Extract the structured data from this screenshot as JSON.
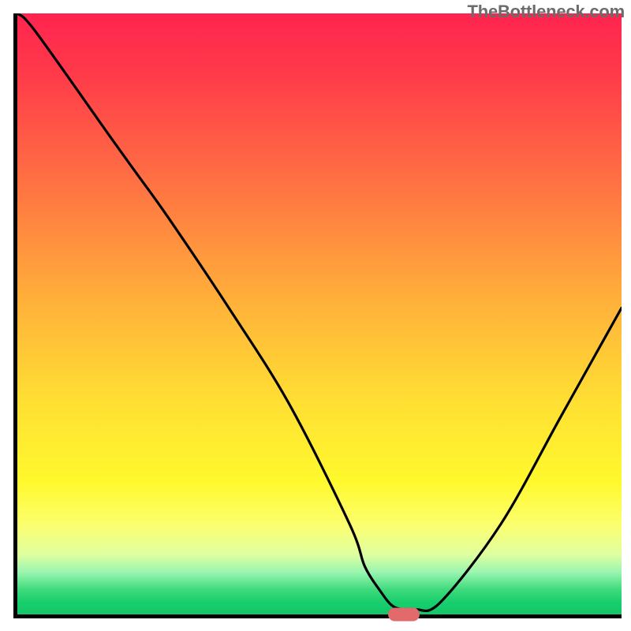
{
  "brand": "TheBottleneck.com",
  "chart_data": {
    "type": "line",
    "title": "",
    "xlabel": "",
    "ylabel": "",
    "xlim": [
      0,
      100
    ],
    "ylim": [
      0,
      100
    ],
    "grid": false,
    "legend": false,
    "series": [
      {
        "name": "bottleneck-curve",
        "x": [
          0,
          3,
          15,
          20,
          25,
          35,
          45,
          55,
          57.5,
          60,
          62,
          64,
          66,
          70,
          80,
          90,
          100
        ],
        "values": [
          100,
          97,
          80,
          73,
          66,
          51,
          35,
          15,
          8,
          4,
          1.5,
          0.8,
          0.8,
          2,
          15,
          33,
          51
        ]
      }
    ],
    "marker": {
      "name": "optimal-marker",
      "x_fraction": 0.64,
      "y_fraction_from_bottom": 0.0,
      "color": "#e26a6a"
    },
    "background_gradient": [
      "#ff244f",
      "#ff3a4a",
      "#ff7742",
      "#ffb13a",
      "#ffe033",
      "#fff92d",
      "#fcff6e",
      "#e0ffa0",
      "#99f5b0",
      "#3bd97a",
      "#17cf6d",
      "#14c568"
    ]
  }
}
